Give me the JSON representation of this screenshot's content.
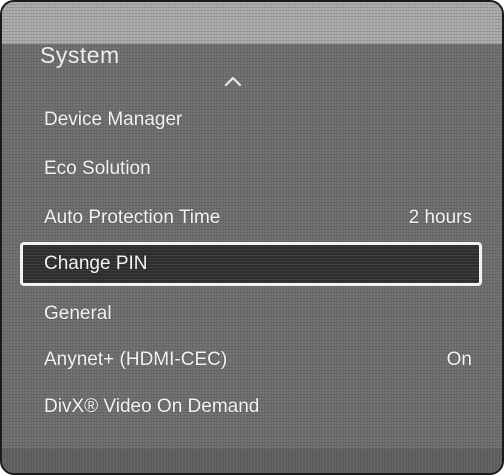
{
  "menu": {
    "title": "System",
    "scroll_indicator_icon": "chevron-up-icon",
    "items": [
      {
        "label": "Device Manager",
        "value": ""
      },
      {
        "label": "Eco Solution",
        "value": ""
      },
      {
        "label": "Auto Protection Time",
        "value": "2 hours"
      },
      {
        "label": "Change PIN",
        "value": "",
        "selected": true
      },
      {
        "label": "General",
        "value": ""
      },
      {
        "label": "Anynet+ (HDMI-CEC)",
        "value": "On"
      },
      {
        "label": "DivX® Video On Demand",
        "value": ""
      }
    ]
  },
  "colors": {
    "panel_background": "#6e6e6e",
    "header_band": "#a8a8a8",
    "selected_background": "#2d2d2d",
    "selected_border": "#f2f2f2",
    "text": "#f4f4f4"
  }
}
